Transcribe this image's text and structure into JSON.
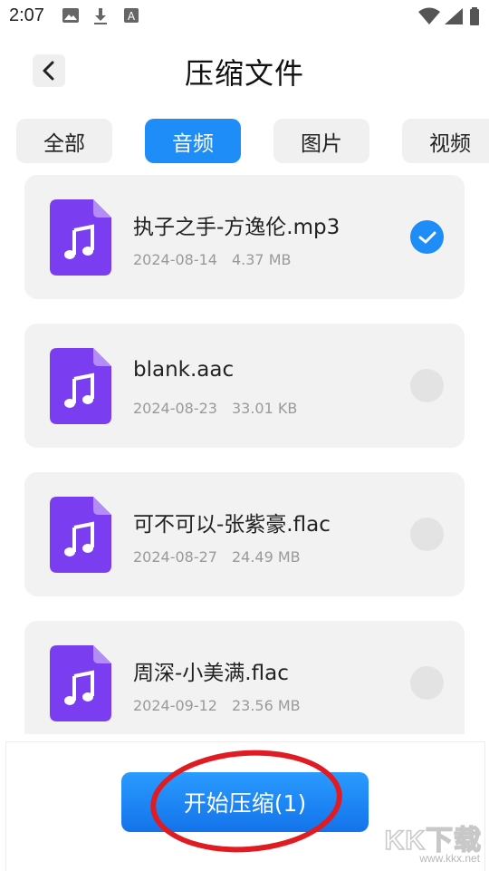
{
  "status_bar": {
    "time": "2:07"
  },
  "header": {
    "title": "压缩文件"
  },
  "tabs": [
    {
      "label": "全部",
      "active": false
    },
    {
      "label": "音频",
      "active": true
    },
    {
      "label": "图片",
      "active": false
    },
    {
      "label": "视频",
      "active": false
    }
  ],
  "files": [
    {
      "name": "执子之手-方逸伦.mp3",
      "date": "2024-08-14",
      "size": "4.37 MB",
      "selected": true
    },
    {
      "name": "blank.aac",
      "date": "2024-08-23",
      "size": "33.01 KB",
      "selected": false
    },
    {
      "name": "可不可以-张紫豪.flac",
      "date": "2024-08-27",
      "size": "24.49 MB",
      "selected": false
    },
    {
      "name": "周深-小美满.flac",
      "date": "2024-09-12",
      "size": "23.56 MB",
      "selected": false
    }
  ],
  "actions": {
    "start_label": "开始压缩(1)"
  },
  "watermark": {
    "logo": "KK下载",
    "url": "www.kkx.net"
  },
  "colors": {
    "accent": "#1e8df7",
    "file_icon": "#7b3df0",
    "annotation": "#e11b22"
  }
}
